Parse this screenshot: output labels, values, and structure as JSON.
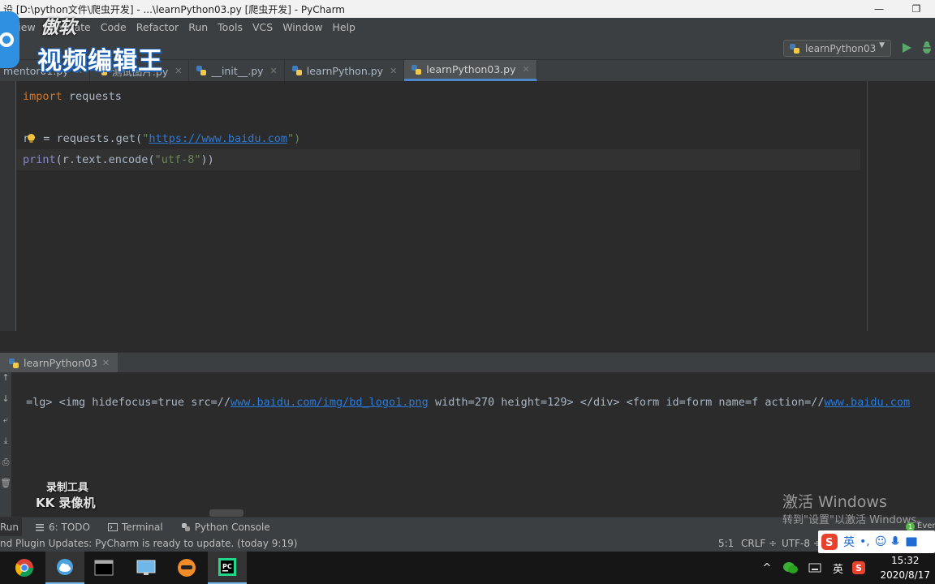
{
  "window": {
    "title": "设 [D:\\python文件\\爬虫开发] - ...\\learnPython03.py [爬虫开发] - PyCharm",
    "controls": {
      "minimize": "—",
      "restore": "❐"
    }
  },
  "menu": [
    "View",
    "Navigate",
    "Code",
    "Refactor",
    "Run",
    "Tools",
    "VCS",
    "Window",
    "Help"
  ],
  "run_config": {
    "name": "learnPython03"
  },
  "tabs": [
    {
      "label": "mentor01.py",
      "active": false
    },
    {
      "label": "测试图片.py",
      "active": false
    },
    {
      "label": "__init__.py",
      "active": false
    },
    {
      "label": "learnPython.py",
      "active": false
    },
    {
      "label": "learnPython03.py",
      "active": true
    }
  ],
  "editor": {
    "line1": {
      "kw": "import",
      "rest": " requests"
    },
    "line3": {
      "pre": "r",
      "mid": " = requests.get(",
      "q1": "\"",
      "url": "https://www.baidu.com",
      "q2": "\")"
    },
    "line4": {
      "fn": "print",
      "mid": "(r.text.",
      "fn2": "encode",
      "open": "(",
      "str": "\"utf-8\"",
      "close": "))"
    }
  },
  "run_panel": {
    "tab_label": "learnPython03",
    "output_prefix": "=lg> <img hidefocus=true src=//",
    "output_link1": "www.baidu.com/img/bd_logo1.png",
    "output_mid": " width=270 height=129> </div> <form id=form name=f action=//",
    "output_link2": "www.baidu.com"
  },
  "tool_windows": [
    {
      "label": "Run",
      "icon": "run-icon"
    },
    {
      "label": "6: TODO",
      "icon": "todo-icon"
    },
    {
      "label": "Terminal",
      "icon": "terminal-icon"
    },
    {
      "label": "Python Console",
      "icon": "python-console-icon"
    }
  ],
  "status": {
    "message": "nd Plugin Updates: PyCharm is ready to update. (today 9:19)",
    "position": "5:1",
    "line_sep": "CRLF ÷",
    "encoding": "UTF-8 ÷"
  },
  "watermarks": {
    "brand_top": "傲软",
    "brand_main": "视频编辑王",
    "kk_line1": "录制工具",
    "kk_line2": "KK 录像机"
  },
  "activation": {
    "line1": "激活 Windows",
    "line2": "转到\"设置\"以激活 Windows。"
  },
  "ime": {
    "lang": "英",
    "notif_count": "1",
    "notif_label": "Ever"
  },
  "taskbar": {
    "tray_lang": "英",
    "time": "15:32",
    "date": "2020/8/17"
  }
}
